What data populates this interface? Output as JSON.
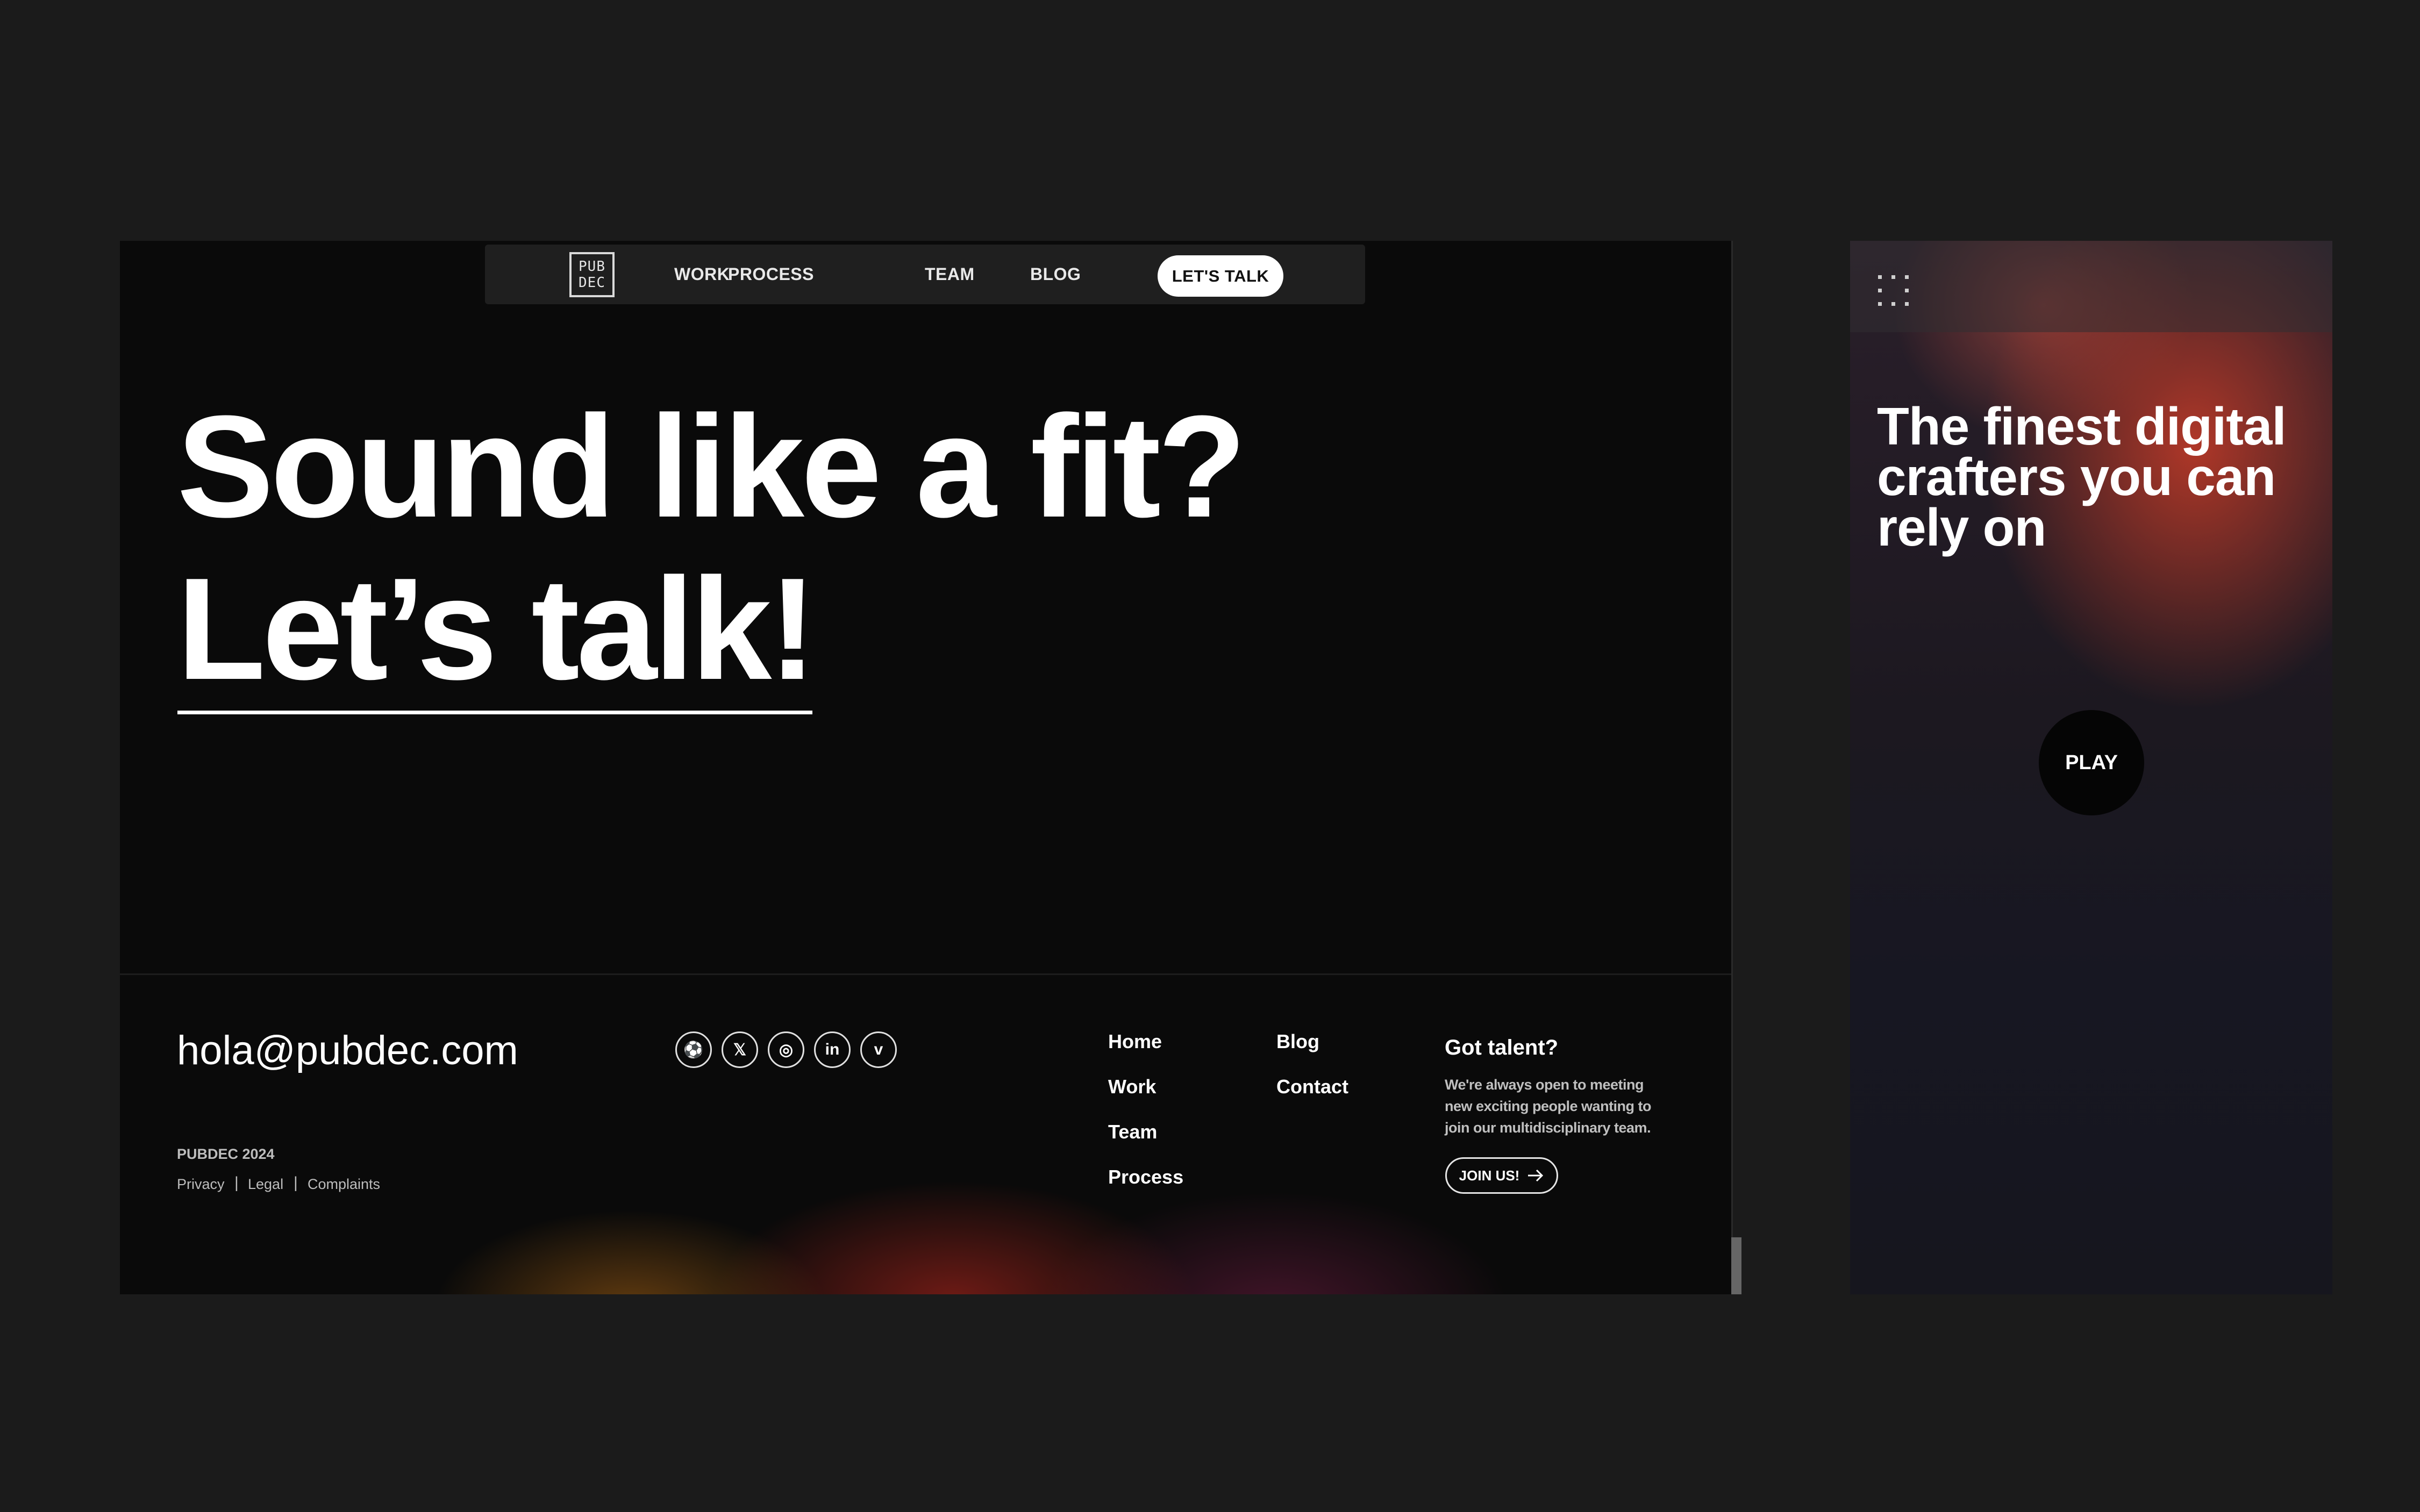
{
  "desktop": {
    "nav": {
      "logo_lines": [
        "PUB",
        "DEC"
      ],
      "links": [
        "WORK",
        "PROCESS",
        "TEAM",
        "BLOG"
      ],
      "cta": "LET'S TALK"
    },
    "hero": {
      "line1": "Sound like a fit?",
      "line2": "Let’s talk!"
    },
    "footer": {
      "email": "hola@pubdec.com",
      "social": [
        "dribbble",
        "x",
        "instagram",
        "linkedin",
        "vimeo"
      ],
      "social_glyphs": [
        "⚽",
        "𝕏",
        "◎",
        "in",
        "v"
      ],
      "copyright": "PUBDEC 2024",
      "legal": [
        "Privacy",
        "Legal",
        "Complaints"
      ],
      "legal_separator": "|",
      "nav_col1": [
        "Home",
        "Work",
        "Team",
        "Process"
      ],
      "nav_col2": [
        "Blog",
        "Contact"
      ],
      "talent": {
        "title": "Got talent?",
        "text": "We're always open to meeting new exciting people wanting to join our multidisciplinary team.",
        "button": "JOIN US!"
      }
    }
  },
  "mobile": {
    "menu_icon": "dots-grid-icon",
    "title": "The finest digital crafters you can rely on",
    "play": "PLAY"
  },
  "colors": {
    "page_bg": "#1b1b1b",
    "frame_bg": "#0a0a0a",
    "nav_bg": "#1f1f1f",
    "accent_red": "#c83c28",
    "accent_orange": "#aa6414"
  }
}
